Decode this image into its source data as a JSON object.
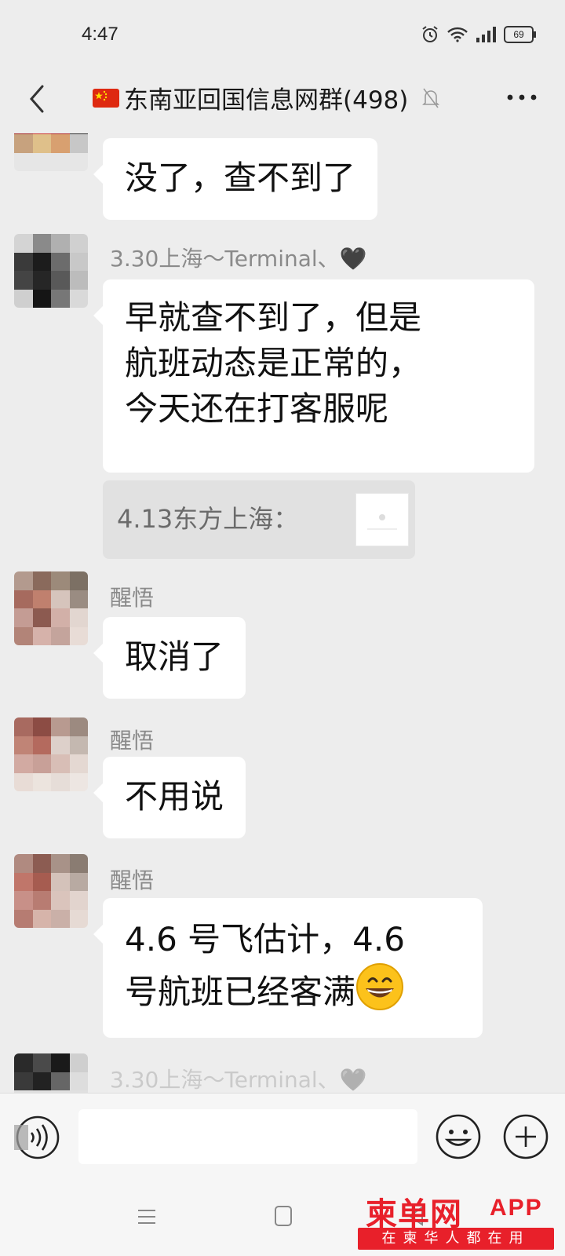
{
  "status_bar": {
    "time": "4:47",
    "battery": "69"
  },
  "header": {
    "title": "东南亚回国信息网群(498)"
  },
  "messages": [
    {
      "sender": "",
      "text": "没了，查不到了"
    },
    {
      "sender": "3.30上海～Terminal、🖤",
      "lines": [
        "早就查不到了，但是",
        "航班动态是正常的，",
        "今天还在打客服呢"
      ]
    },
    {
      "quote": "4.13东方上海："
    },
    {
      "sender": "醒悟",
      "text": "取消了"
    },
    {
      "sender": "醒悟",
      "text": "不用说"
    },
    {
      "sender": "醒悟",
      "lines": [
        "4.6 号飞估计，4.6",
        "号航班已经客满"
      ],
      "emoji": "grinning-face"
    }
  ],
  "input_bar": {
    "placeholder": ""
  },
  "watermark": {
    "logo": "柬单网",
    "app": "APP",
    "slogan": "在柬华人都在用"
  },
  "colors": {
    "background": "#ededed",
    "bubble": "#ffffff",
    "watermark_red": "#e8202a"
  }
}
